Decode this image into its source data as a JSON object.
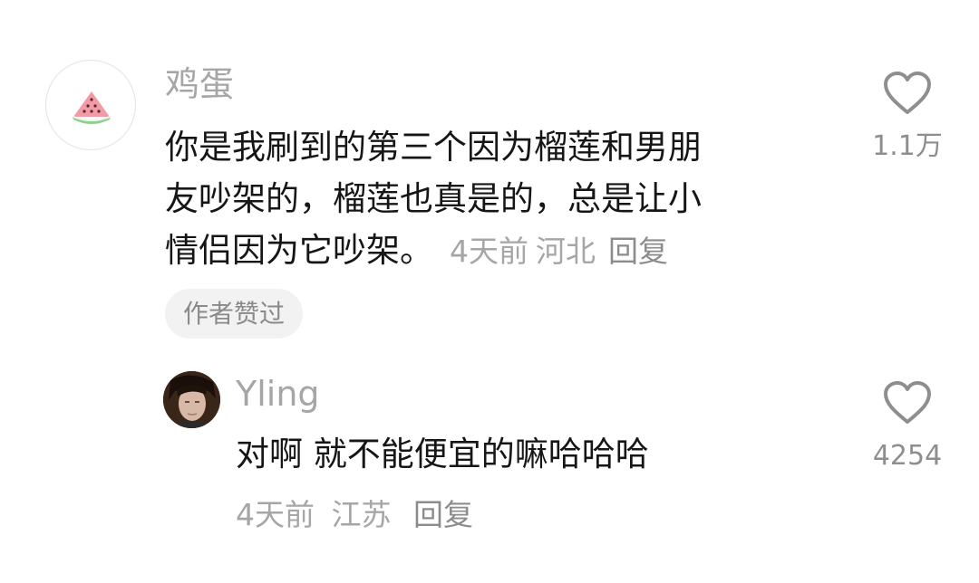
{
  "comments": [
    {
      "username": "鸡蛋",
      "avatar_icon": "watermelon-icon",
      "text_lines": [
        "你是我刷到的第三个因为榴莲和男朋",
        "友吵架的，榴莲也真是的，总是让小",
        "情侣因为它吵架。"
      ],
      "time": "4天前",
      "location": "河北",
      "reply_label": "回复",
      "badge": "作者赞过",
      "like_icon": "heart-outline-icon",
      "likes": "1.1万"
    },
    {
      "username": "Yling",
      "avatar_icon": "person-photo-avatar",
      "text": "对啊 就不能便宜的嘛哈哈哈",
      "time": "4天前",
      "location": "江苏",
      "reply_label": "回复",
      "like_icon": "heart-outline-icon",
      "likes": "4254"
    }
  ],
  "colors": {
    "username": "#a6a6a6",
    "body_text": "#161616",
    "meta": "#a6a6a6",
    "badge_bg": "#f2f2f2",
    "icon_stroke": "#8e8e8e"
  }
}
